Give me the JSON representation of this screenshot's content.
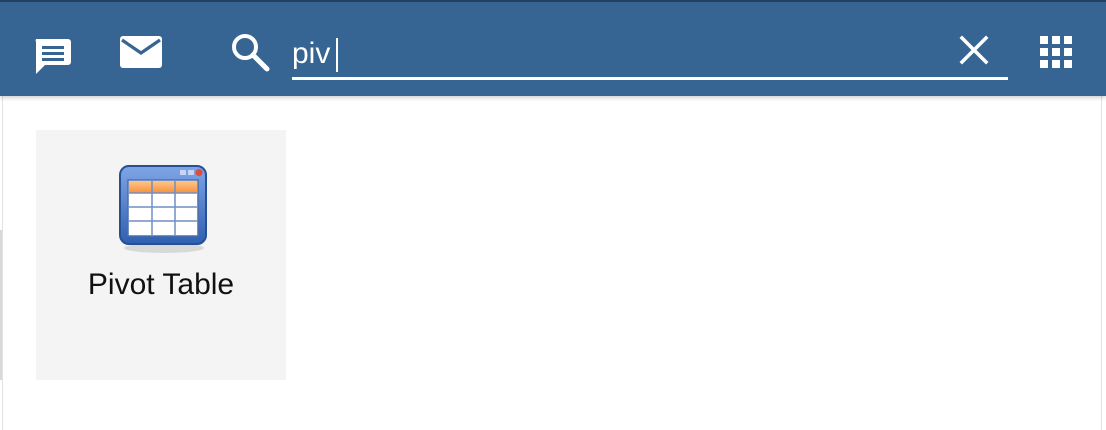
{
  "header": {
    "chat_icon": "chat-icon",
    "mail_icon": "mail-icon",
    "apps_icon": "apps-grid-icon",
    "background_color": "#366593"
  },
  "search": {
    "value": "piv",
    "icon": "search-icon",
    "clear_icon": "close-icon"
  },
  "results": [
    {
      "label": "Pivot Table",
      "icon": "pivot-table-icon"
    }
  ]
}
